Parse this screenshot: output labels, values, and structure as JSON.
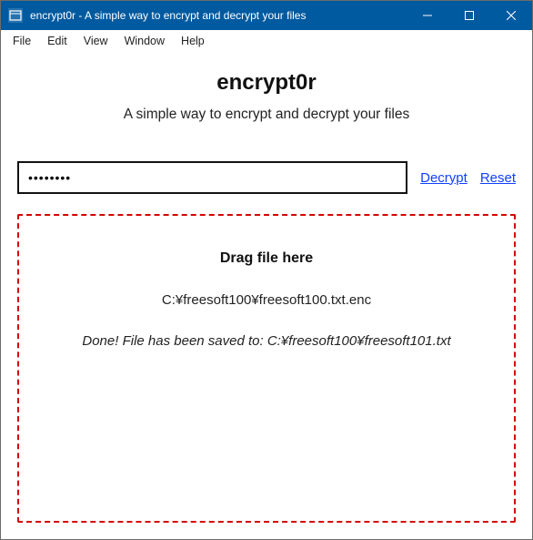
{
  "window": {
    "title": "encrypt0r - A simple way to encrypt and decrypt your files"
  },
  "menu": {
    "items": [
      "File",
      "Edit",
      "View",
      "Window",
      "Help"
    ]
  },
  "main": {
    "heading": "encrypt0r",
    "subheading": "A simple way to encrypt and decrypt your files",
    "password_value": "••••••••",
    "decrypt_label": "Decrypt",
    "reset_label": "Reset"
  },
  "dropzone": {
    "title": "Drag file here",
    "path": "C:¥freesoft100¥freesoft100.txt.enc",
    "status": "Done! File has been saved to: C:¥freesoft100¥freesoft101.txt"
  }
}
